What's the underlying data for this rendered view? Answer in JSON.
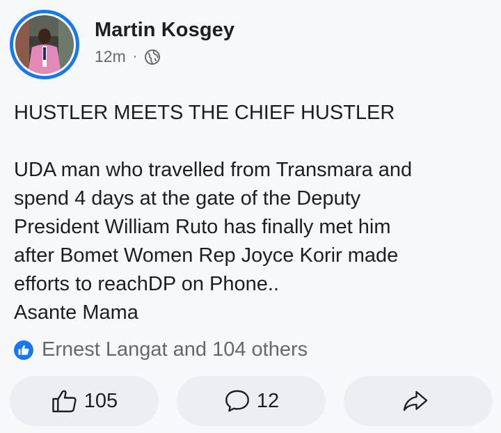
{
  "post": {
    "author": "Martin Kosgey",
    "time": "12m",
    "separator": "·",
    "privacy_icon": "globe-icon",
    "headline": "HUSTLER MEETS THE CHIEF HUSTLER",
    "body_lines": [
      "UDA man who travelled from Transmara and",
      "spend 4 days at the gate of the Deputy",
      "President William Ruto has finally met him",
      "after Bomet Women Rep Joyce Korir made",
      "efforts to reachDP on Phone.."
    ],
    "closing": "Asante Mama"
  },
  "reactions": {
    "icon": "like-icon",
    "summary": "Ernest Langat and 104 others"
  },
  "actions": {
    "like_count": "105",
    "comment_count": "12",
    "share_icon": "share-icon"
  },
  "colors": {
    "accent": "#1877f2",
    "background": "#f7f8fa",
    "button": "#eceef1",
    "secondary_text": "#65676b"
  }
}
